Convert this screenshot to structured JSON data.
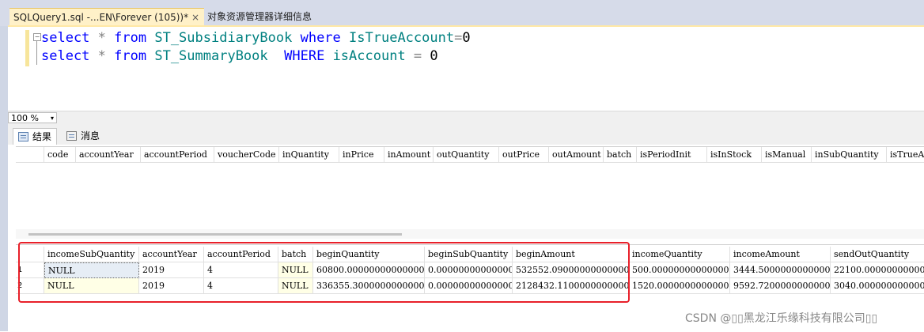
{
  "tabs": {
    "active_label": "SQLQuery1.sql -...EN\\Forever (105))*",
    "close_glyph": "×",
    "inactive_label": "对象资源管理器详细信息"
  },
  "editor": {
    "line1": {
      "kw1": "select",
      "star": " * ",
      "kw2": "from",
      "sp1": " ",
      "table": "ST_SubsidiaryBook",
      "sp2": " ",
      "kw3": "where",
      "sp3": " ",
      "col": "IsTrueAccount",
      "op": "=",
      "val": "0"
    },
    "line2": {
      "kw1": "select",
      "star": " * ",
      "kw2": "from",
      "sp1": " ",
      "table": "ST_SummaryBook",
      "sp2": "  ",
      "kw3": "WHERE",
      "sp3": " ",
      "col": "isAccount",
      "op": " = ",
      "val": "0"
    }
  },
  "zoom": {
    "value": "100 %",
    "arrow": "▾"
  },
  "results_tabs": {
    "results": "结果",
    "messages": "消息"
  },
  "grid1": {
    "columns": [
      "code",
      "accountYear",
      "accountPeriod",
      "voucherCode",
      "inQuantity",
      "inPrice",
      "inAmount",
      "outQuantity",
      "outPrice",
      "outAmount",
      "batch",
      "isPeriodInit",
      "isInStock",
      "isManual",
      "inSubQuantity",
      "isTrueA"
    ]
  },
  "grid2": {
    "columns": [
      "incomeSubQuantity",
      "accountYear",
      "accountPeriod",
      "batch",
      "beginQuantity",
      "beginSubQuantity",
      "beginAmount",
      "incomeQuantity",
      "incomeAmount",
      "sendOutQuantity"
    ],
    "rows": [
      {
        "num": "1",
        "cells": [
          "NULL",
          "2019",
          "4",
          "NULL",
          "60800.00000000000000",
          "0.00000000000000",
          "532552.09000000000000",
          "500.00000000000000",
          "3444.50000000000000",
          "22100.00000000000000"
        ]
      },
      {
        "num": "2",
        "cells": [
          "NULL",
          "2019",
          "4",
          "NULL",
          "336355.30000000000000",
          "0.00000000000000",
          "2128432.11000000000000",
          "1520.00000000000000",
          "9592.72000000000000",
          "3040.00000000000000"
        ]
      }
    ]
  },
  "watermark": "CSDN @▯▯黑龙江乐缘科技有限公司▯▯"
}
